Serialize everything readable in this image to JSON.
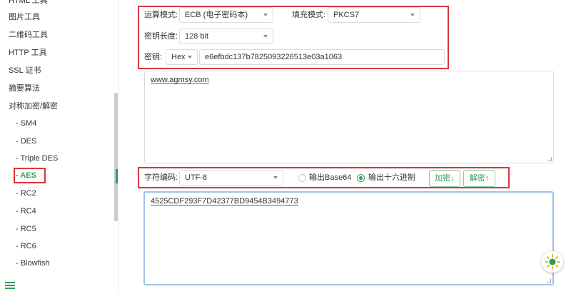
{
  "sidebar": {
    "top_cut_item": "HTML 工具",
    "items": [
      "图片工具",
      "二维码工具",
      "HTTP 工具",
      "SSL 证书",
      "摘要算法",
      "对称加密/解密"
    ],
    "sub_items": [
      "- SM4",
      "- DES",
      "- Triple DES",
      "- AES",
      "- RC2",
      "- RC4",
      "- RC5",
      "- RC6",
      "- Blowfish"
    ],
    "active": "- AES"
  },
  "config": {
    "mode_label": "运算模式:",
    "mode_value": "ECB (电子密码本)",
    "padding_label": "填充模式:",
    "padding_value": "PKCS7",
    "keylen_label": "密钥长度:",
    "keylen_value": "128 bit",
    "key_label": "密钥:",
    "key_format": "Hex",
    "key_value": "e6efbdc137b7825093226513e03a1063"
  },
  "plaintext": "www.agmsy.com",
  "controls": {
    "charset_label": "字符编码:",
    "charset_value": "UTF-8",
    "output_base64": "输出Base64",
    "output_hex": "输出十六进制",
    "output_selected": "hex",
    "encrypt_label": "加密↓",
    "decrypt_label": "解密↑"
  },
  "ciphertext": "4525CDF293F7D42377BD9454B3494773",
  "colors": {
    "accent": "#2e9b57",
    "highlight_box": "#d9363e",
    "focus_border": "#9ec1ea"
  }
}
